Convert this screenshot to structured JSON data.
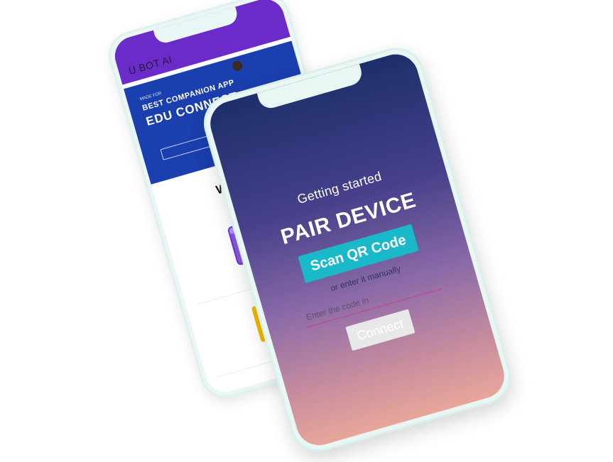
{
  "back_phone": {
    "appbar_title": "U BOT AI",
    "banner": {
      "kicker": "MADE FOR",
      "line1": "BEST COMPANION APP",
      "line2": "EDU CONNECT",
      "subtitle": "",
      "cta": ""
    },
    "welcome": "Welco",
    "tiles": [
      {
        "icon": "video-window-icon"
      },
      {
        "icon": "folder-icon"
      },
      {
        "icon": "figure-illustration-icon"
      }
    ]
  },
  "front_phone": {
    "subtitle": "Getting started",
    "title": "PAIR DEVICE",
    "scan_button": "Scan QR Code",
    "or_manual": "or enter it manually",
    "code_placeholder": "Enter the code in",
    "connect_button": "Connect"
  },
  "colors": {
    "back_appbar": "#6b2bc8",
    "back_banner": "#1a3fae",
    "scan_button": "#19b9c9",
    "gradient_top": "#1d2f6b",
    "gradient_bottom": "#e8a69a"
  }
}
